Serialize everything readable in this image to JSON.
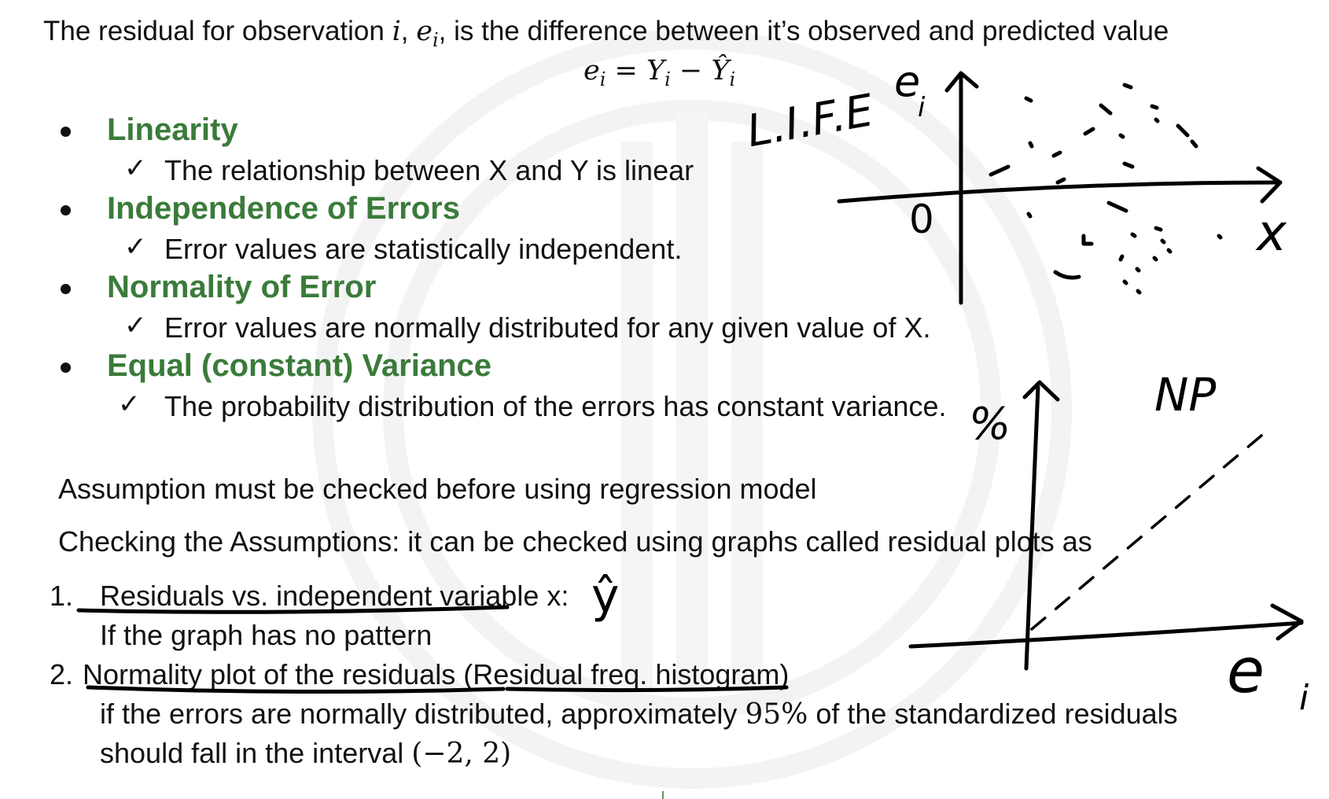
{
  "intro": {
    "prefix": "The residual for observation ",
    "var_i": "i",
    "comma1": ", ",
    "var_ei": "e",
    "sub_i": "i",
    "suffix": ", is the difference between it’s observed and predicted value"
  },
  "formula": {
    "lhs": "e",
    "lhs_sub": "i",
    "eq": " = ",
    "y": "Y",
    "y_sub": "i",
    "minus": " − ",
    "yhat": "Ŷ",
    "yhat_sub": "i"
  },
  "assumptions": [
    {
      "title": "Linearity",
      "detail": "The relationship between X and Y is linear"
    },
    {
      "title": "Independence of Errors",
      "detail": "Error values are statistically independent."
    },
    {
      "title": "Normality of Error",
      "detail": "Error values are normally distributed for any given value of X."
    },
    {
      "title": "Equal (constant) Variance",
      "detail": "The probability distribution of the errors has constant variance."
    }
  ],
  "check_mark": "✓",
  "para1": "Assumption must be checked before using regression model",
  "para2": "Checking the Assumptions: it can be checked using graphs called residual plots as",
  "items": [
    {
      "num": "1.",
      "title": "Residuals vs. independent variable x:",
      "detail": "If the graph has no pattern"
    },
    {
      "num": "2.",
      "title": "Normality plot of the residuals (Residual freq. histogram)"
    }
  ],
  "item2_line1": {
    "a": "if the errors are normally distributed, approximately ",
    "pct": "95%",
    "b": " of the standardized residuals"
  },
  "item2_line2": {
    "a": "should fall in the interval ",
    "interval": "(−2, 2)"
  },
  "handwriting": {
    "life": "L.I.F.E",
    "ei_top": "e",
    "ei_top_sub": "i",
    "zero": "0",
    "x_label": "x",
    "percent": "%",
    "np": "NP",
    "ei_bottom": "e",
    "ei_bottom_sub": "i",
    "y_hat_mark": "ŷ"
  },
  "colors": {
    "heading_green": "#3a7b3a",
    "ink": "#000000"
  }
}
